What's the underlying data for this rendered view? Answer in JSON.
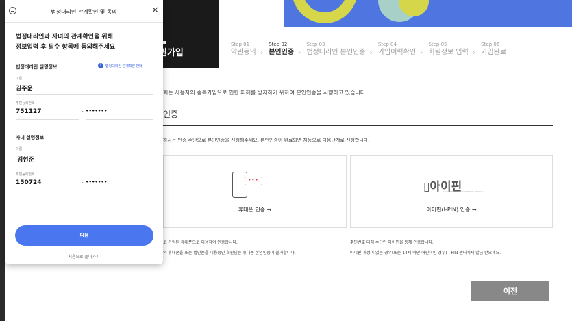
{
  "page": {
    "banner_title": "원가입",
    "steps": [
      {
        "no": "Step 01",
        "name": "약관동의"
      },
      {
        "no": "Step 02",
        "name": "본인인증"
      },
      {
        "no": "Step 03",
        "name": "법정대리인 본인인증"
      },
      {
        "no": "Step 04",
        "name": "가입이력확인"
      },
      {
        "no": "Step 05",
        "name": "회원정보 입력"
      },
      {
        "no": "Step 06",
        "name": "가입완료"
      }
    ],
    "active_step_index": 1,
    "notice": "회는 사용자의 중복가입으로 인한 피해를 방지하기 위하여 본인인증을 시행하고 있습니다.",
    "section_title": "인증",
    "description": "하시는 인증 수단으로 본인인증을 진행해주세요. 본인인증이 완료되면 자동으로 다음단계로 진행합니다.",
    "phone_card_label": "휴대폰 인증 →",
    "ipin_card_label": "아이핀(I-PIN) 인증 →",
    "phone_bubble": "•••",
    "ipin_logo": "아이핀",
    "ipin_sub": "Internet Personal Identification Number",
    "notes_left": [
      "로 가입된 휴대폰으로 이용하여 인증합니다.",
      "의 휴대폰을 또는 법인폰을 이용중인 회원님은 휴대폰 본인인증이 불가합니다."
    ],
    "notes_right": [
      "주민번호 대체 수단인 아이핀을 통해 인증합니다.",
      "아이핀 계정이 없는 경우(또는 14세 미만 어린이인 경우) I-PIN 센터에서 발급 받으세요."
    ],
    "prev_button": "이전"
  },
  "modal": {
    "title": "법정대리인 관계확인 및 동의",
    "close_glyph": "✕",
    "lead_line1": "법정대리인과 자녀의 관계확인을 위해",
    "lead_line2": "정보입력 후 필수 항목에 동의해주세요",
    "guardian_section": "법정대리인 실명정보",
    "info_link": "법정대리인 관계확인 안내",
    "info_glyph": "i",
    "child_section": "자녀 실명정보",
    "name_label": "이름",
    "rrn_label": "주민등록번호",
    "guardian_name": "김주운",
    "guardian_rrn_front": "751127",
    "guardian_rrn_back": "•••••••",
    "child_name": "김현준",
    "child_rrn_front": "150724",
    "child_rrn_back": "•••••••",
    "dash": "-",
    "next_button": "다음",
    "back_link": "처음으로 돌아가기"
  },
  "colors": {
    "primary": "#4a76f0",
    "link": "#3a64e0",
    "banner": "#1a1a1a",
    "prev_button": "#888888"
  }
}
